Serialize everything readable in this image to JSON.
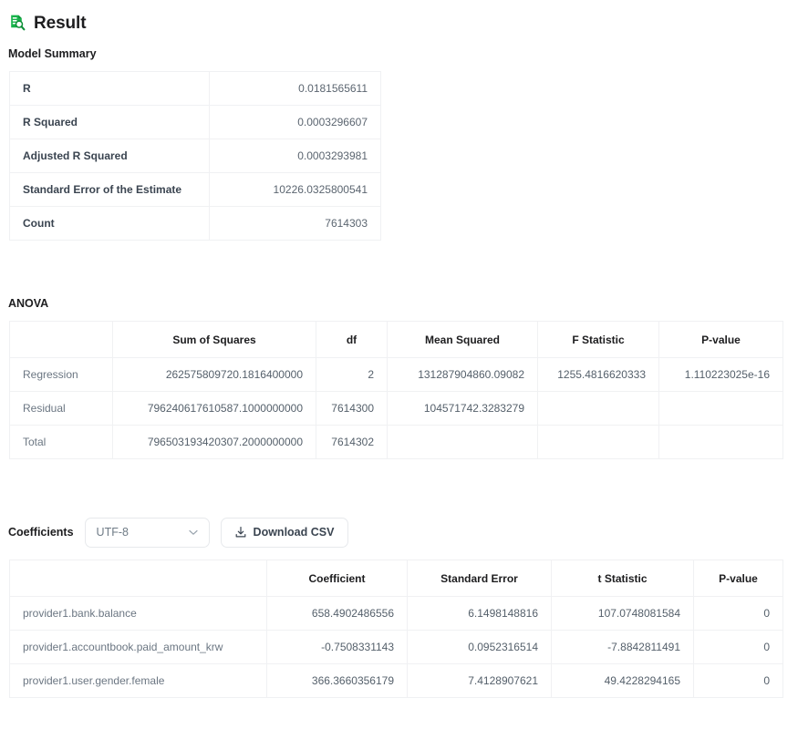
{
  "page": {
    "title": "Result",
    "title_icon": "report-search-icon",
    "accent_green": "#1faa4e",
    "heading_color": "#1d1d1f",
    "value_color": "#5b6570",
    "border_color": "#f0f1f3"
  },
  "model_summary": {
    "heading": "Model Summary",
    "rows": [
      {
        "label": "R",
        "value": "0.0181565611"
      },
      {
        "label": "R Squared",
        "value": "0.0003296607"
      },
      {
        "label": "Adjusted R Squared",
        "value": "0.0003293981"
      },
      {
        "label": "Standard Error of the Estimate",
        "value": "10226.0325800541"
      },
      {
        "label": "Count",
        "value": "7614303"
      }
    ]
  },
  "anova": {
    "heading": "ANOVA",
    "columns": [
      "",
      "Sum of Squares",
      "df",
      "Mean Squared",
      "F Statistic",
      "P-value"
    ],
    "rows": [
      {
        "label": "Regression",
        "sum_of_squares": "262575809720.1816400000",
        "df": "2",
        "mean_squared": "131287904860.09082",
        "f_statistic": "1255.4816620333",
        "p_value": "1.110223025e-16"
      },
      {
        "label": "Residual",
        "sum_of_squares": "796240617610587.1000000000",
        "df": "7614300",
        "mean_squared": "104571742.3283279",
        "f_statistic": "",
        "p_value": ""
      },
      {
        "label": "Total",
        "sum_of_squares": "796503193420307.2000000000",
        "df": "7614302",
        "mean_squared": "",
        "f_statistic": "",
        "p_value": ""
      }
    ]
  },
  "coefficients": {
    "heading": "Coefficients",
    "encoding_select": {
      "value": "UTF-8",
      "icon": "chevron-down-icon"
    },
    "download_button": {
      "label": "Download CSV",
      "icon": "download-icon"
    },
    "columns": [
      "",
      "Coefficient",
      "Standard Error",
      "t Statistic",
      "P-value"
    ],
    "rows": [
      {
        "label": "provider1.bank.balance",
        "coefficient": "658.4902486556",
        "standard_error": "6.1498148816",
        "t_statistic": "107.0748081584",
        "p_value": "0"
      },
      {
        "label": "provider1.accountbook.paid_amount_krw",
        "coefficient": "-0.7508331143",
        "standard_error": "0.0952316514",
        "t_statistic": "-7.8842811491",
        "p_value": "0"
      },
      {
        "label": "provider1.user.gender.female",
        "coefficient": "366.3660356179",
        "standard_error": "7.4128907621",
        "t_statistic": "49.4228294165",
        "p_value": "0"
      }
    ]
  }
}
